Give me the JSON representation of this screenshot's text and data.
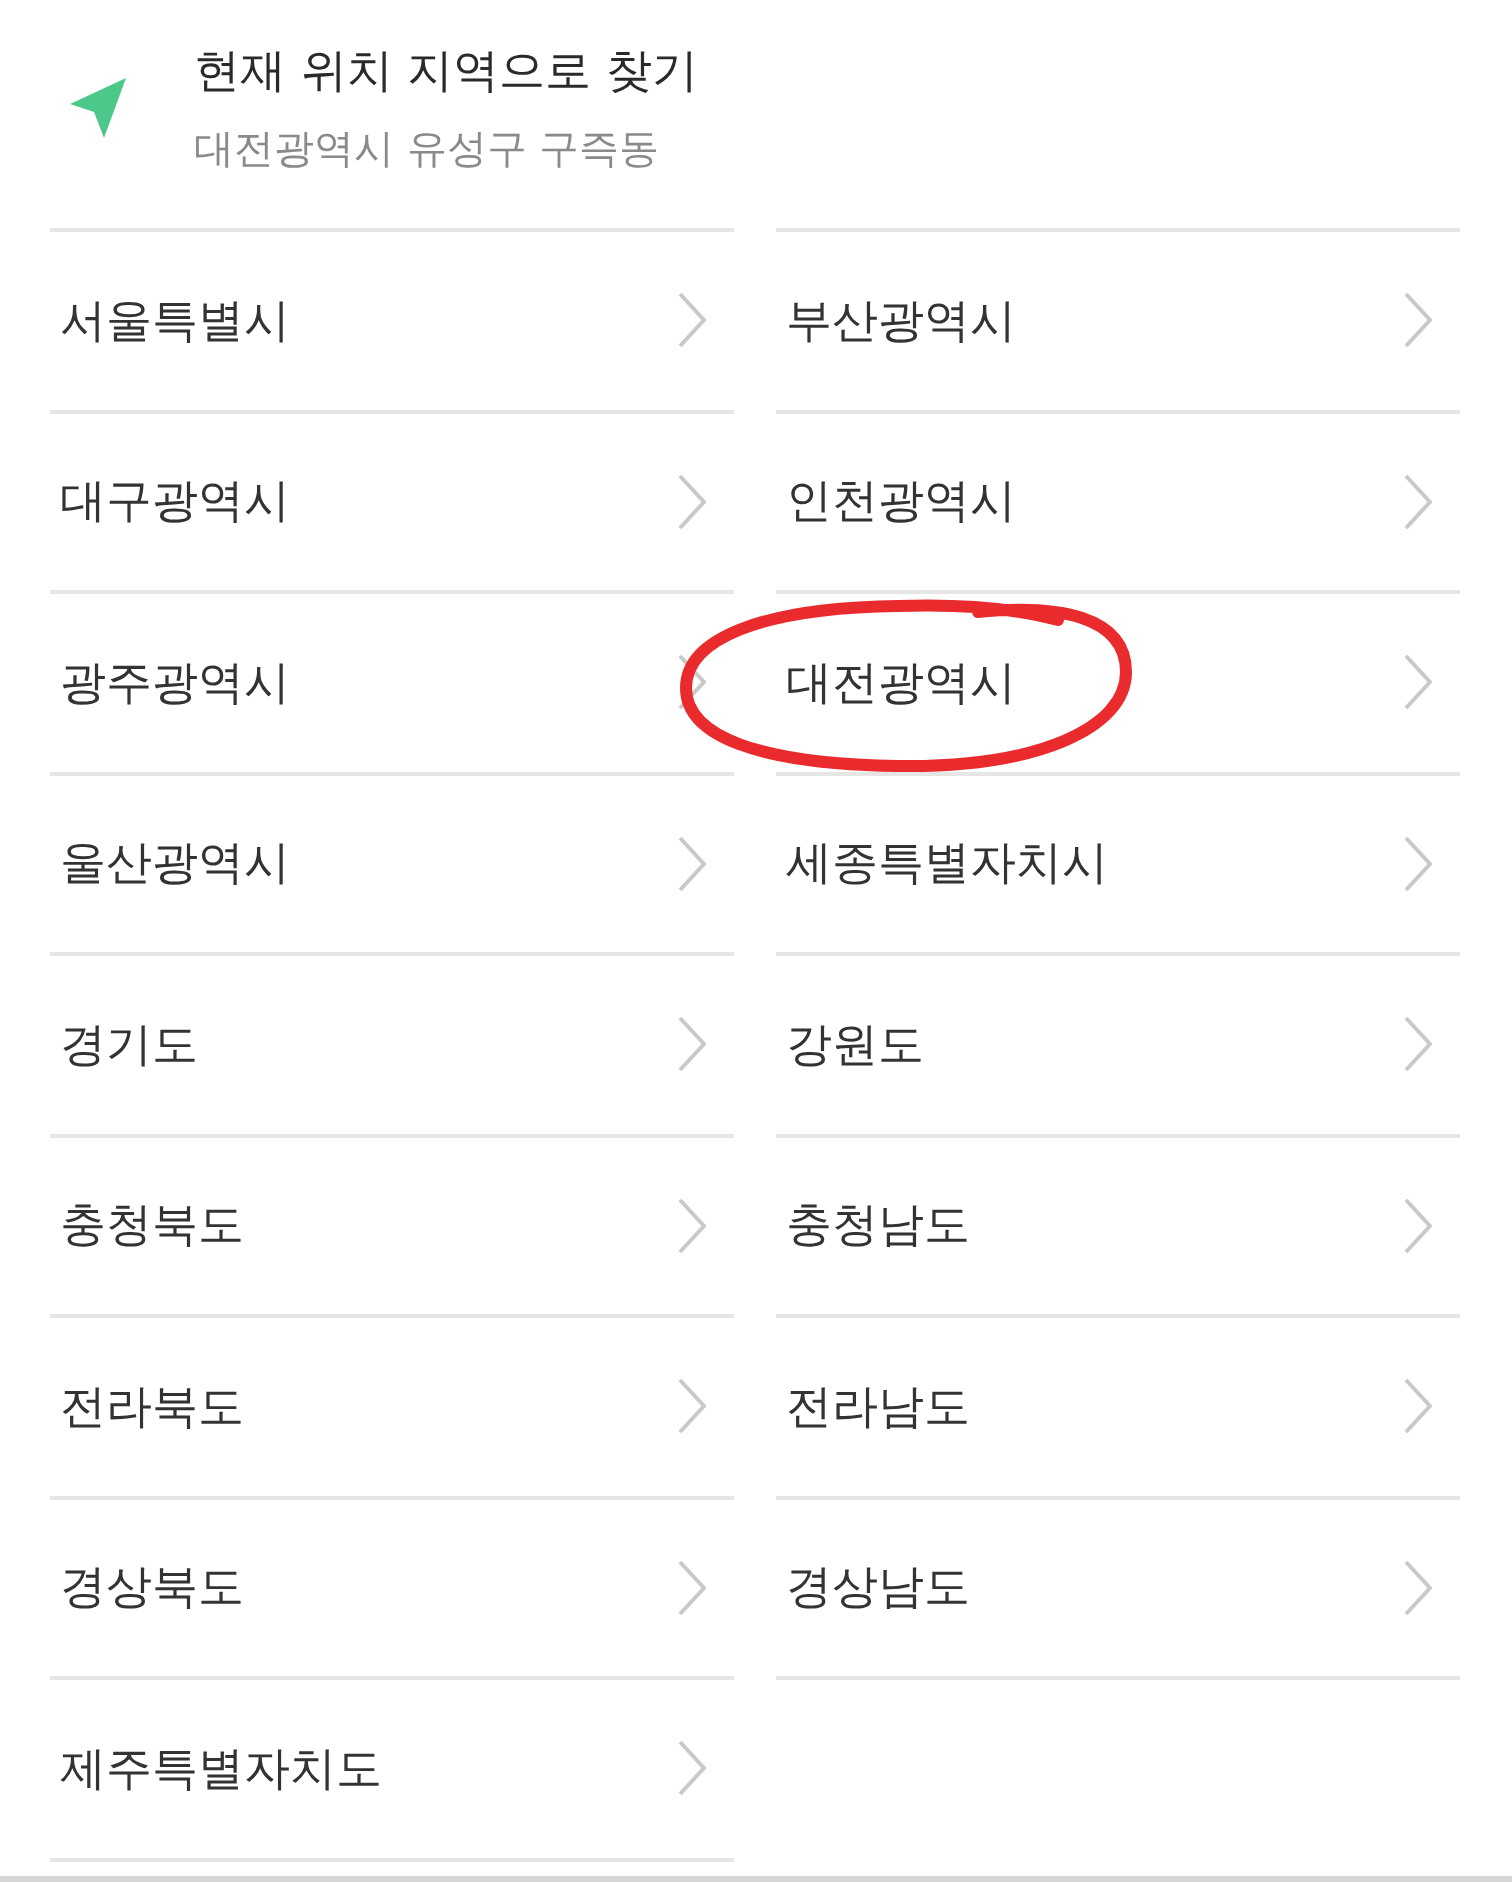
{
  "location": {
    "title": "현재 위치 지역으로 찾기",
    "address": "대전광역시 유성구 구즉동"
  },
  "regions": [
    {
      "name": "서울특별시",
      "circled": false
    },
    {
      "name": "부산광역시",
      "circled": false
    },
    {
      "name": "대구광역시",
      "circled": false
    },
    {
      "name": "인천광역시",
      "circled": false
    },
    {
      "name": "광주광역시",
      "circled": false
    },
    {
      "name": "대전광역시",
      "circled": true
    },
    {
      "name": "울산광역시",
      "circled": false
    },
    {
      "name": "세종특별자치시",
      "circled": false
    },
    {
      "name": "경기도",
      "circled": false
    },
    {
      "name": "강원도",
      "circled": false
    },
    {
      "name": "충청북도",
      "circled": false
    },
    {
      "name": "충청남도",
      "circled": false
    },
    {
      "name": "전라북도",
      "circled": false
    },
    {
      "name": "전라남도",
      "circled": false
    },
    {
      "name": "경상북도",
      "circled": false
    },
    {
      "name": "경상남도",
      "circled": false
    },
    {
      "name": "제주특별자치도",
      "circled": false
    }
  ]
}
